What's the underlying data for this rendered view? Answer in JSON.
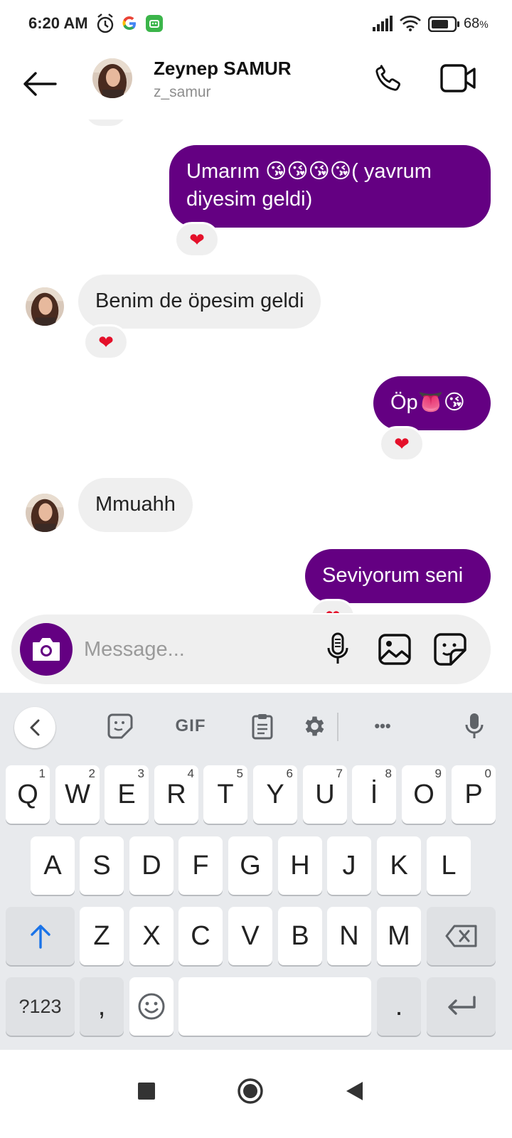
{
  "status_bar": {
    "time": "6:20 AM",
    "battery": "68",
    "battery_unit": "%",
    "icons": [
      "alarm-icon",
      "google-icon",
      "app-icon",
      "signal-icon",
      "wifi-icon",
      "battery-icon"
    ]
  },
  "header": {
    "name": "Zeynep SAMUR",
    "username": "z_samur",
    "icons": [
      "back-arrow-icon",
      "phone-icon",
      "video-icon"
    ]
  },
  "messages": [
    {
      "id": "m1",
      "direction": "outgoing",
      "text": "Umarım 😘😘😘😘( yavrum diyesim geldi)",
      "line1": "Umarım",
      "line1_emojis": "😘😘😘😘",
      "line1_tail": "( yavrum",
      "line2": "diyesim geldi)",
      "reaction": "❤"
    },
    {
      "id": "m2",
      "direction": "incoming",
      "text": "Benim de öpesim geldi",
      "reaction": "❤"
    },
    {
      "id": "m3",
      "direction": "outgoing",
      "text": "Öp👅😘",
      "text_main": "Öp",
      "emojis": "👅😘",
      "reaction": "❤"
    },
    {
      "id": "m4",
      "direction": "incoming",
      "text": "Mmuahh"
    },
    {
      "id": "m5",
      "direction": "outgoing",
      "text": "Seviyorum seni",
      "reaction": "❤"
    }
  ],
  "top_partial_reaction": "❤",
  "composer": {
    "placeholder": "Message...",
    "icons": [
      "camera-icon",
      "microphone-icon",
      "gallery-icon",
      "sticker-icon"
    ]
  },
  "keyboard": {
    "toolbar": {
      "gif_label": "GIF",
      "more_label": "•••",
      "icons": [
        "chevron-left-icon",
        "sticker-icon",
        "clipboard-icon",
        "settings-icon",
        "microphone-icon"
      ]
    },
    "row1": [
      {
        "key": "Q",
        "num": "1"
      },
      {
        "key": "W",
        "num": "2"
      },
      {
        "key": "E",
        "num": "3"
      },
      {
        "key": "R",
        "num": "4"
      },
      {
        "key": "T",
        "num": "5"
      },
      {
        "key": "Y",
        "num": "6"
      },
      {
        "key": "U",
        "num": "7"
      },
      {
        "key": "İ",
        "num": "8"
      },
      {
        "key": "O",
        "num": "9"
      },
      {
        "key": "P",
        "num": "0"
      }
    ],
    "row2": [
      "A",
      "S",
      "D",
      "F",
      "G",
      "H",
      "J",
      "K",
      "L"
    ],
    "row3": [
      "Z",
      "X",
      "C",
      "V",
      "B",
      "N",
      "M"
    ],
    "row4": {
      "symbols": "?123",
      "comma": ",",
      "period": "."
    },
    "accent_color": "#1a73e8"
  },
  "colors": {
    "outgoing_bubble": "#640082",
    "incoming_bubble": "#efefef",
    "reaction_heart": "#e4102a"
  },
  "navbar": {
    "icons": [
      "recents-square-icon",
      "home-circle-icon",
      "back-triangle-icon"
    ]
  }
}
